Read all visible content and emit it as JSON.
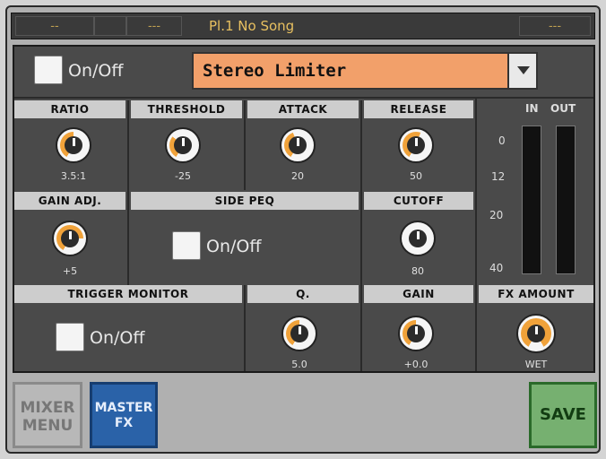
{
  "topbar": {
    "seg1": "--",
    "seg2": "---",
    "title": "Pl.1 No Song",
    "seg_right": "---"
  },
  "header": {
    "onoff_label": "On/Off",
    "effect_name": "Stereo Limiter"
  },
  "controls": {
    "ratio": {
      "label": "RATIO",
      "value": "3.5:1"
    },
    "threshold": {
      "label": "THRESHOLD",
      "value": "-25"
    },
    "attack": {
      "label": "ATTACK",
      "value": "20"
    },
    "release": {
      "label": "RELEASE",
      "value": "50"
    },
    "gain_adj": {
      "label": "GAIN ADJ.",
      "value": "+5"
    },
    "side_peq": {
      "label": "SIDE PEQ",
      "onoff_label": "On/Off"
    },
    "cutoff": {
      "label": "CUTOFF",
      "value": "80"
    },
    "trigger_monitor": {
      "label": "TRIGGER MONITOR",
      "onoff_label": "On/Off"
    },
    "q": {
      "label": "Q.",
      "value": "5.0"
    },
    "gain": {
      "label": "GAIN",
      "value": "+0.0"
    },
    "fx_amount": {
      "label": "FX AMOUNT",
      "value": "WET"
    }
  },
  "meter": {
    "in_label": "IN",
    "out_label": "OUT",
    "scale": [
      "0",
      "12",
      "20",
      "40"
    ]
  },
  "buttons": {
    "mixer_menu_line1": "MIXER",
    "mixer_menu_line2": "MENU",
    "master_fx_line1": "MASTER",
    "master_fx_line2": "FX",
    "save": "SAVE"
  },
  "colors": {
    "knob_accent": "#f0a23a",
    "dropdown_bg": "#f2a06a",
    "master_button": "#2a62a8",
    "save_button": "#76b070"
  }
}
